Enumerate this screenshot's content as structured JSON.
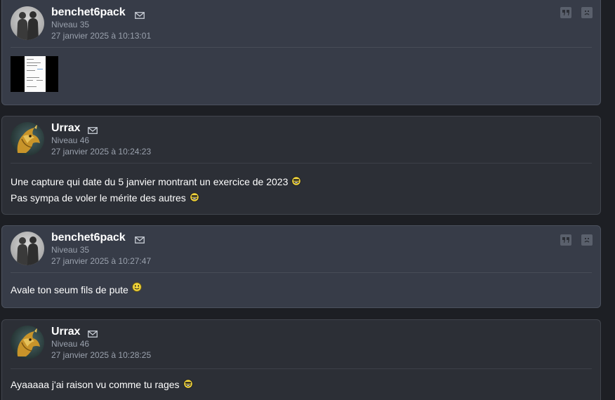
{
  "colors": {
    "own_post_bg": "#373c48",
    "other_post_bg": "#2c2f36",
    "text": "#ffffff",
    "meta": "#9aa1ad",
    "smiley_yellow": "#f2d53a"
  },
  "posts": [
    {
      "author": "benchet6pack",
      "level": "Niveau 35",
      "date": "27 janvier 2025 à 10:13:01",
      "avatar": "silhouette-avatar",
      "mail_icon": "mail-icon",
      "actions": [
        "quote-icon",
        "report-icon"
      ],
      "attachment": "image-thumbnail",
      "lines": []
    },
    {
      "author": "Urrax",
      "level": "Niveau 46",
      "date": "27 janvier 2025 à 10:24:23",
      "avatar": "dragon-avatar",
      "mail_icon": "mail-icon",
      "lines": [
        {
          "text": "Une capture qui date du 5 janvier montrant un exercice de 2023",
          "smiley": "rire-smiley"
        },
        {
          "text": "Pas sympa de voler le mérite des autres",
          "smiley": "rire-smiley"
        }
      ]
    },
    {
      "author": "benchet6pack",
      "level": "Niveau 35",
      "date": "27 janvier 2025 à 10:27:47",
      "avatar": "silhouette-avatar",
      "mail_icon": "mail-icon",
      "actions": [
        "quote-icon",
        "report-icon"
      ],
      "lines": [
        {
          "text": "Avale ton seum fils de pute",
          "smiley": "sourire-smiley"
        }
      ]
    },
    {
      "author": "Urrax",
      "level": "Niveau 46",
      "date": "27 janvier 2025 à 10:28:25",
      "avatar": "dragon-avatar",
      "mail_icon": "mail-icon",
      "lines": [
        {
          "text": "Ayaaaaa j'ai raison vu comme tu rages",
          "smiley": "rire-smiley"
        }
      ]
    }
  ]
}
